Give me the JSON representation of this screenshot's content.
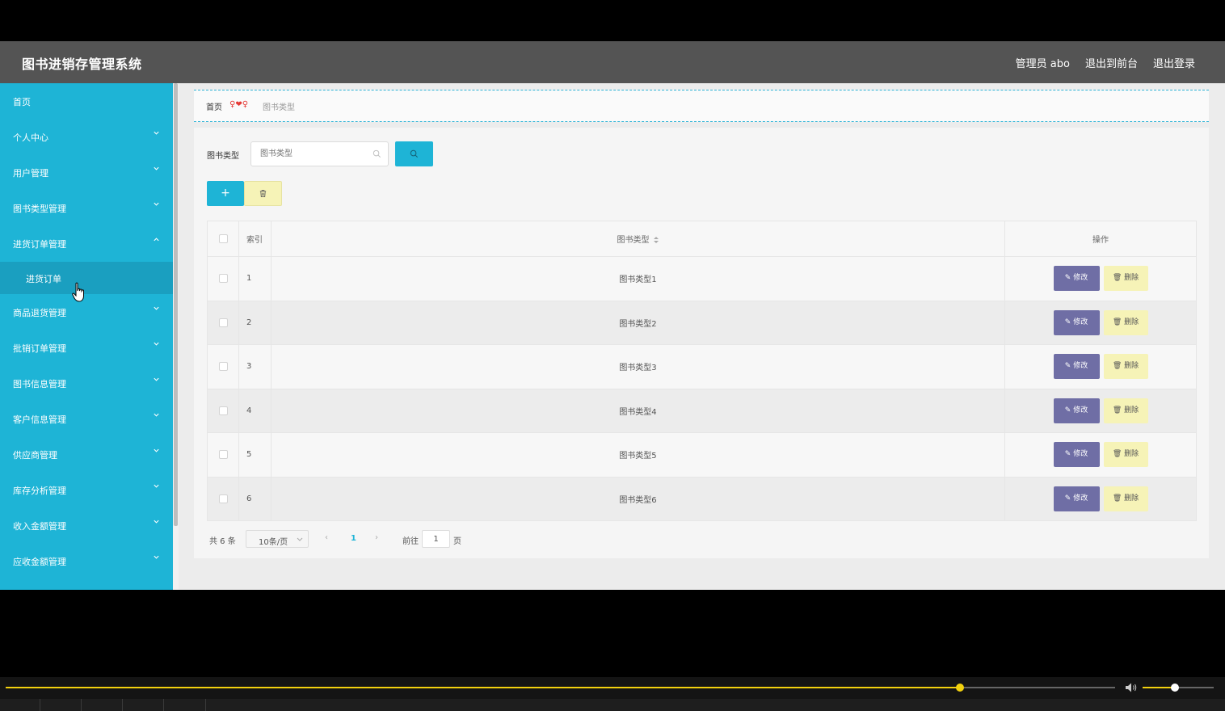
{
  "header": {
    "title": "图书进销存管理系统",
    "nav": [
      "管理员 abo",
      "退出到前台",
      "退出登录"
    ]
  },
  "sidebar": {
    "items": [
      {
        "label": "首页",
        "has_children": false
      },
      {
        "label": "个人中心",
        "has_children": true,
        "expanded": false
      },
      {
        "label": "用户管理",
        "has_children": true,
        "expanded": false
      },
      {
        "label": "图书类型管理",
        "has_children": true,
        "expanded": false
      },
      {
        "label": "进货订单管理",
        "has_children": true,
        "expanded": true,
        "children": [
          "进货订单"
        ]
      },
      {
        "label": "商品退货管理",
        "has_children": true,
        "expanded": false
      },
      {
        "label": "批销订单管理",
        "has_children": true,
        "expanded": false
      },
      {
        "label": "图书信息管理",
        "has_children": true,
        "expanded": false
      },
      {
        "label": "客户信息管理",
        "has_children": true,
        "expanded": false
      },
      {
        "label": "供应商管理",
        "has_children": true,
        "expanded": false
      },
      {
        "label": "库存分析管理",
        "has_children": true,
        "expanded": false
      },
      {
        "label": "收入金额管理",
        "has_children": true,
        "expanded": false
      },
      {
        "label": "应收金额管理",
        "has_children": true,
        "expanded": false
      }
    ]
  },
  "breadcrumb": {
    "home": "首页",
    "separator": "♀❤♀",
    "current": "图书类型"
  },
  "search": {
    "label": "图书类型",
    "placeholder": "图书类型",
    "value": ""
  },
  "toolbar": {
    "add_label": "+"
  },
  "table": {
    "columns": [
      "索引",
      "图书类型",
      "操作"
    ],
    "rows": [
      {
        "index": "1",
        "type": "图书类型1"
      },
      {
        "index": "2",
        "type": "图书类型2"
      },
      {
        "index": "3",
        "type": "图书类型3"
      },
      {
        "index": "4",
        "type": "图书类型4"
      },
      {
        "index": "5",
        "type": "图书类型5"
      },
      {
        "index": "6",
        "type": "图书类型6"
      }
    ],
    "edit_label": "修改",
    "delete_label": "删除"
  },
  "pagination": {
    "total": "共 6 条",
    "page_size": "10条/页",
    "current_page": "1",
    "goto_label": "前往",
    "goto_value": "1",
    "page_suffix": "页"
  },
  "player": {
    "progress": 0.86,
    "volume": 0.45
  },
  "colors": {
    "header": "#545454",
    "sidebar": "#1eb4d6",
    "sidebar_active": "#1a9fc0",
    "edit_button": "#6f6ea5",
    "delete_button": "#f6f3b7",
    "accent": "#f2d10e"
  }
}
